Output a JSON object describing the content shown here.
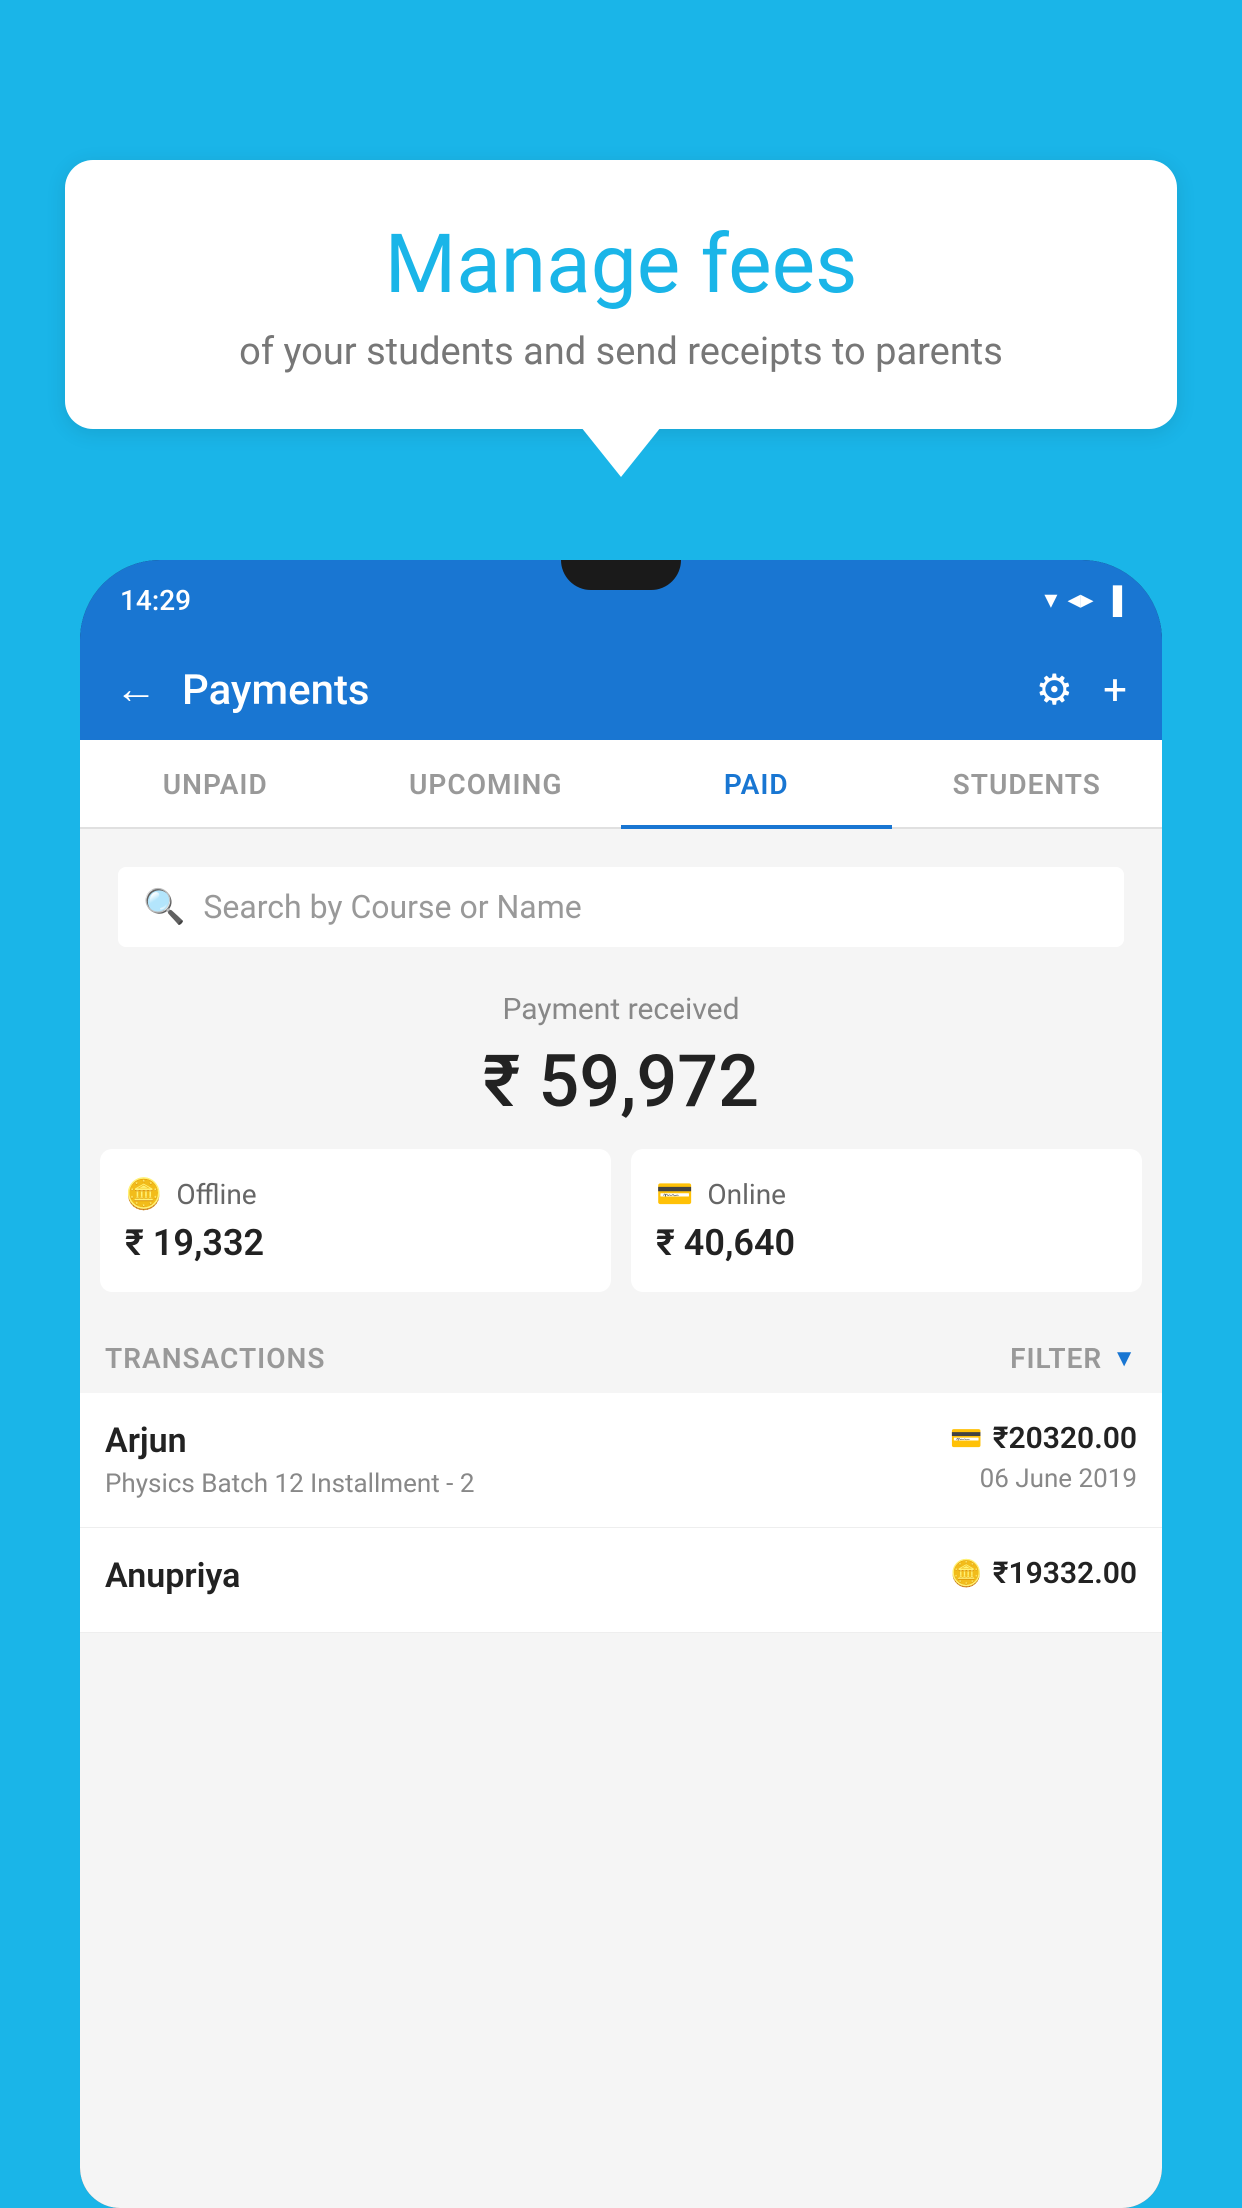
{
  "background_color": "#1ab5e8",
  "bubble": {
    "title": "Manage fees",
    "subtitle": "of your students and send receipts to parents"
  },
  "status_bar": {
    "time": "14:29",
    "wifi": "▾",
    "signal": "▲",
    "battery": "▌"
  },
  "header": {
    "title": "Payments",
    "back_label": "←",
    "gear_label": "⚙",
    "plus_label": "+"
  },
  "tabs": [
    {
      "label": "UNPAID",
      "active": false
    },
    {
      "label": "UPCOMING",
      "active": false
    },
    {
      "label": "PAID",
      "active": true
    },
    {
      "label": "STUDENTS",
      "active": false
    }
  ],
  "search": {
    "placeholder": "Search by Course or Name"
  },
  "payment_received": {
    "label": "Payment received",
    "amount": "₹ 59,972"
  },
  "payment_cards": [
    {
      "icon": "offline",
      "label": "Offline",
      "amount": "₹ 19,332"
    },
    {
      "icon": "online",
      "label": "Online",
      "amount": "₹ 40,640"
    }
  ],
  "transactions_label": "TRANSACTIONS",
  "filter_label": "FILTER",
  "transactions": [
    {
      "name": "Arjun",
      "course": "Physics Batch 12 Installment - 2",
      "amount": "₹20320.00",
      "date": "06 June 2019",
      "payment_type": "card"
    },
    {
      "name": "Anupriya",
      "course": "",
      "amount": "₹19332.00",
      "date": "",
      "payment_type": "cash"
    }
  ]
}
